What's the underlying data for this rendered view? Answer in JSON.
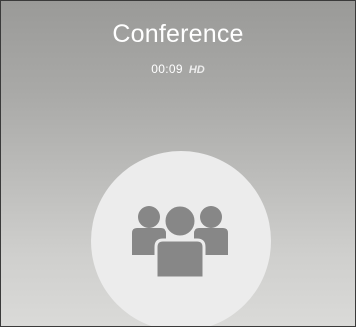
{
  "call": {
    "title": "Conference",
    "timer": "00:09",
    "quality_badge": "HD"
  },
  "avatar": {
    "icon": "group-icon",
    "background_color": "#ececec",
    "icon_color": "#878787"
  }
}
